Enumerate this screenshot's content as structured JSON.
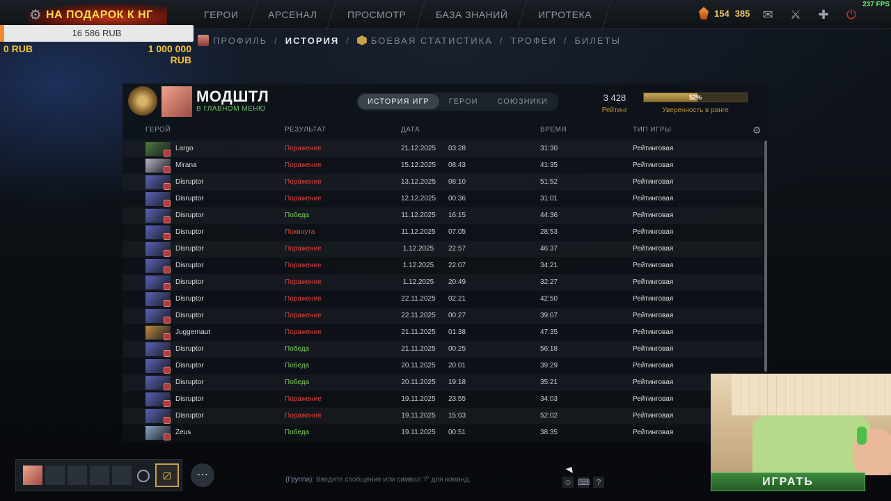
{
  "topbar": {
    "gift_label": "НА ПОДАРОК К НГ",
    "nav": [
      "ГЕРОИ",
      "АРСЕНАЛ",
      "ПРОСМОТР",
      "БАЗА ЗНАНИЙ",
      "ИГРОТЕКА"
    ],
    "shards_value": "154",
    "other_value": "385",
    "fps": "237 FPS"
  },
  "donation": {
    "current": "16 586 RUB",
    "min": "0 RUB",
    "max": "1 000 000 RUB",
    "progress_fraction": 0.016586
  },
  "subnav": {
    "items": [
      "ПРОФИЛЬ",
      "ИСТОРИЯ",
      "БОЕВАЯ СТАТИСТИКА",
      "ТРОФЕИ",
      "БИЛЕТЫ"
    ]
  },
  "profile": {
    "name": "МОДШТЛ",
    "status": "В ГЛАВНОМ МЕНЮ",
    "rating_value": "3 428",
    "rating_label": "Рейтинг",
    "confidence_pct": "52%",
    "confidence_fraction": 0.52,
    "confidence_label": "Уверенность в ранге"
  },
  "tabs": [
    "ИСТОРИЯ ИГР",
    "ГЕРОИ",
    "СОЮЗНИКИ"
  ],
  "table": {
    "headers": {
      "hero": "ГЕРОЙ",
      "result": "РЕЗУЛЬТАТ",
      "date": "ДАТА",
      "duration": "ВРЕМЯ",
      "type": "ТИП ИГРЫ"
    },
    "rows": [
      {
        "hero": "Largo",
        "result": "Поражение",
        "kind": "loss",
        "date": "21.12.2025",
        "time": "03:28",
        "duration": "31:30",
        "type": "Рейтинговая",
        "color": "#4c7a3a"
      },
      {
        "hero": "Mirana",
        "result": "Поражение",
        "kind": "loss",
        "date": "15.12.2025",
        "time": "08:43",
        "duration": "41:35",
        "type": "Рейтинговая",
        "color": "#b9b2c6"
      },
      {
        "hero": "Disruptor",
        "result": "Поражение",
        "kind": "loss",
        "date": "13.12.2025",
        "time": "08:10",
        "duration": "51:52",
        "type": "Рейтинговая",
        "color": "#5a62b8"
      },
      {
        "hero": "Disruptor",
        "result": "Поражение",
        "kind": "loss",
        "date": "12.12.2025",
        "time": "00:36",
        "duration": "31:01",
        "type": "Рейтинговая",
        "color": "#5a62b8"
      },
      {
        "hero": "Disruptor",
        "result": "Победа",
        "kind": "win",
        "date": "11.12.2025",
        "time": "16:15",
        "duration": "44:36",
        "type": "Рейтинговая",
        "color": "#5a62b8"
      },
      {
        "hero": "Disruptor",
        "result": "Покинута",
        "kind": "abandon",
        "date": "11.12.2025",
        "time": "07:05",
        "duration": "28:53",
        "type": "Рейтинговая",
        "color": "#5a62b8"
      },
      {
        "hero": "Disruptor",
        "result": "Поражение",
        "kind": "loss",
        "date": "1.12.2025",
        "time": "22:57",
        "duration": "46:37",
        "type": "Рейтинговая",
        "color": "#5a62b8"
      },
      {
        "hero": "Disruptor",
        "result": "Поражение",
        "kind": "loss",
        "date": "1.12.2025",
        "time": "22:07",
        "duration": "34:21",
        "type": "Рейтинговая",
        "color": "#5a62b8"
      },
      {
        "hero": "Disruptor",
        "result": "Поражение",
        "kind": "loss",
        "date": "1.12.2025",
        "time": "20:49",
        "duration": "32:27",
        "type": "Рейтинговая",
        "color": "#5a62b8"
      },
      {
        "hero": "Disruptor",
        "result": "Поражение",
        "kind": "loss",
        "date": "22.11.2025",
        "time": "02:21",
        "duration": "42:50",
        "type": "Рейтинговая",
        "color": "#5a62b8"
      },
      {
        "hero": "Disruptor",
        "result": "Поражение",
        "kind": "loss",
        "date": "22.11.2025",
        "time": "00:27",
        "duration": "39:07",
        "type": "Рейтинговая",
        "color": "#5a62b8"
      },
      {
        "hero": "Juggernaut",
        "result": "Поражение",
        "kind": "loss",
        "date": "21.11.2025",
        "time": "01:38",
        "duration": "47:35",
        "type": "Рейтинговая",
        "color": "#c08a3a"
      },
      {
        "hero": "Disruptor",
        "result": "Победа",
        "kind": "win",
        "date": "21.11.2025",
        "time": "00:25",
        "duration": "56:18",
        "type": "Рейтинговая",
        "color": "#5a62b8"
      },
      {
        "hero": "Disruptor",
        "result": "Победа",
        "kind": "win",
        "date": "20.11.2025",
        "time": "20:01",
        "duration": "39:29",
        "type": "Рейтинговая",
        "color": "#5a62b8"
      },
      {
        "hero": "Disruptor",
        "result": "Победа",
        "kind": "win",
        "date": "20.11.2025",
        "time": "19:18",
        "duration": "35:21",
        "type": "Рейтинговая",
        "color": "#5a62b8"
      },
      {
        "hero": "Disruptor",
        "result": "Поражение",
        "kind": "loss",
        "date": "19.11.2025",
        "time": "23:55",
        "duration": "34:03",
        "type": "Рейтинговая",
        "color": "#5a62b8"
      },
      {
        "hero": "Disruptor",
        "result": "Поражение",
        "kind": "loss",
        "date": "19.11.2025",
        "time": "15:03",
        "duration": "52:02",
        "type": "Рейтинговая",
        "color": "#5a62b8"
      },
      {
        "hero": "Zeus",
        "result": "Победа",
        "kind": "win",
        "date": "19.11.2025",
        "time": "00:51",
        "duration": "38:35",
        "type": "Рейтинговая",
        "color": "#8aa6c8"
      }
    ]
  },
  "chat": {
    "group_label": "(Группа):",
    "placeholder": "Введите сообщение или символ \"/\" для команд."
  },
  "play_button": "ИГРАТЬ",
  "icons": {
    "settings": "gear-icon",
    "shards": "shard-icon",
    "chat": "chat-icon",
    "armory": "armory-icon",
    "plus": "plus-icon",
    "power": "power-icon"
  }
}
